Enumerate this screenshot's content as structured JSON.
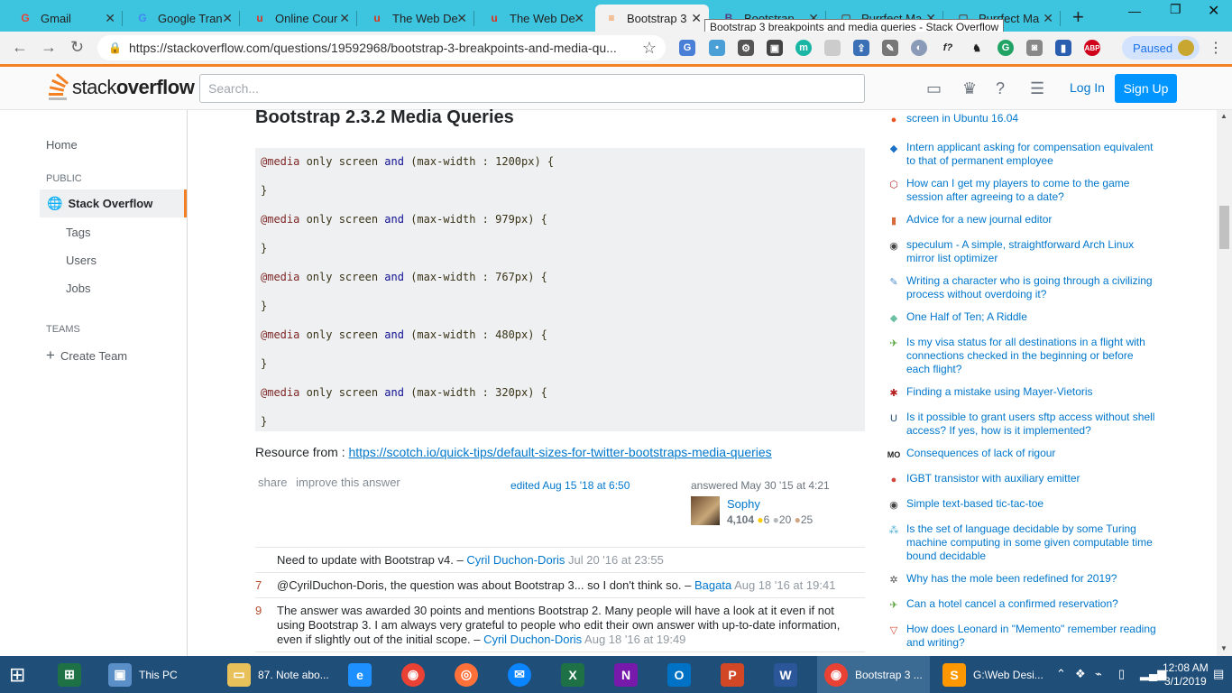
{
  "browser": {
    "tabs": [
      {
        "title": "Gmail",
        "icon": "G",
        "color": "#ea4335"
      },
      {
        "title": "Google Tran",
        "icon": "G",
        "color": "#4285f4"
      },
      {
        "title": "Online Cour",
        "icon": "u",
        "color": "#e0321c"
      },
      {
        "title": "The Web De",
        "icon": "u",
        "color": "#e0321c"
      },
      {
        "title": "The Web De",
        "icon": "u",
        "color": "#e0321c"
      },
      {
        "title": "Bootstrap 3",
        "icon": "≡",
        "color": "#f48024"
      },
      {
        "title": "Bootstrap",
        "icon": "B",
        "color": "#563d7c"
      },
      {
        "title": "Purrfect Ma",
        "icon": "▢",
        "color": "#555555"
      },
      {
        "title": "Purrfect Ma",
        "icon": "▢",
        "color": "#555555"
      }
    ],
    "tooltip": "Bootstrap 3 breakpoints and media queries - Stack Overflow",
    "url": "https://stackoverflow.com/questions/19592968/bootstrap-3-breakpoints-and-media-qu...",
    "paused_label": "Paused"
  },
  "header": {
    "logo_prefix": "stack",
    "logo_suffix": "overflow",
    "search_placeholder": "Search...",
    "login": "Log In",
    "signup": "Sign Up"
  },
  "nav": {
    "home": "Home",
    "public": "PUBLIC",
    "stackoverflow": "Stack Overflow",
    "tags": "Tags",
    "users": "Users",
    "jobs": "Jobs",
    "teams": "TEAMS",
    "create_team": "Create Team"
  },
  "answer": {
    "heading": "Bootstrap 2.3.2 Media Queries",
    "code": [
      {
        "at": "@media",
        "mid1": " only screen ",
        "and": "and",
        "mid2": " (max-width : 1200px) {"
      },
      {
        "close": "}"
      },
      {
        "at": "@media",
        "mid1": " only screen ",
        "and": "and",
        "mid2": " (max-width : 979px) {"
      },
      {
        "close": "}"
      },
      {
        "at": "@media",
        "mid1": " only screen ",
        "and": "and",
        "mid2": " (max-width : 767px) {"
      },
      {
        "close": "}"
      },
      {
        "at": "@media",
        "mid1": " only screen ",
        "and": "and",
        "mid2": " (max-width : 480px) {"
      },
      {
        "close": "}"
      },
      {
        "at": "@media",
        "mid1": " only screen ",
        "and": "and",
        "mid2": " (max-width : 320px) {"
      },
      {
        "close": "}"
      }
    ],
    "resource_label": "Resource from : ",
    "resource_link": "https://scotch.io/quick-tips/default-sizes-for-twitter-bootstraps-media-queries",
    "share": "share",
    "improve": "improve this answer",
    "edited": "edited Aug 15 '18 at 6:50",
    "answered": "answered May 30 '15 at 4:21",
    "user": {
      "name": "Sophy",
      "rep": "4,104",
      "gold": "6",
      "silver": "20",
      "bronze": "25"
    }
  },
  "comments": [
    {
      "score": "",
      "text": "Need to update with Bootstrap v4. – ",
      "author": "Cyril Duchon-Doris",
      "date": " Jul 20 '16 at 23:55"
    },
    {
      "score": "7",
      "text": "@CyrilDuchon-Doris, the question was about Bootstrap 3... so I don't think so. – ",
      "author": "Bagata",
      "date": " Aug 18 '16 at 19:41"
    },
    {
      "score": "9",
      "text": "The answer was awarded 30 points and mentions Bootstrap 2. Many people will have a look at it even if not using Bootstrap 3. I am always very grateful to people who edit their own answer with up-to-date information, even if slightly out of the initial scope. – ",
      "author": "Cyril Duchon-Doris",
      "date": " Aug 18 '16 at 19:49"
    }
  ],
  "hot_questions": [
    {
      "text": "screen in Ubuntu 16.04",
      "icon": "ubuntu-icon",
      "glyph": "●",
      "color": "#e95420"
    },
    {
      "text": "Intern applicant asking for compensation equivalent to that of permanent employee",
      "icon": "workplace-icon",
      "glyph": "◆",
      "color": "#1a6fc9"
    },
    {
      "text": "How can I get my players to come to the game session after agreeing to a date?",
      "icon": "rpg-icon",
      "glyph": "⬡",
      "color": "#b5292d"
    },
    {
      "text": "Advice for a new journal editor",
      "icon": "academia-icon",
      "glyph": "▮",
      "color": "#d86a39"
    },
    {
      "text": "speculum - A simple, straightforward Arch Linux mirror list optimizer",
      "icon": "codereview-icon",
      "glyph": "◉",
      "color": "#444444"
    },
    {
      "text": "Writing a character who is going through a civilizing process without overdoing it?",
      "icon": "writing-icon",
      "glyph": "✎",
      "color": "#4d8ed0"
    },
    {
      "text": "One Half of Ten; A Riddle",
      "icon": "puzzling-icon",
      "glyph": "◆",
      "color": "#6ac0a0"
    },
    {
      "text": "Is my visa status for all destinations in a flight with connections checked in the beginning or before each flight?",
      "icon": "travel-icon",
      "glyph": "✈",
      "color": "#58a33c"
    },
    {
      "text": "Finding a mistake using Mayer-Vietoris",
      "icon": "math-icon",
      "glyph": "✱",
      "color": "#b51d1d"
    },
    {
      "text": "Is it possible to grant users sftp access without shell access? If yes, how is it implemented?",
      "icon": "unix-icon",
      "glyph": "U",
      "color": "#234e74"
    },
    {
      "text": "Consequences of lack of rigour",
      "icon": "mathoverflow-icon",
      "glyph": "MO",
      "color": "#222222"
    },
    {
      "text": "IGBT transistor with auxiliary emitter",
      "icon": "electronics-icon",
      "glyph": "●",
      "color": "#d1463a"
    },
    {
      "text": "Simple text-based tic-tac-toe",
      "icon": "codereview-icon",
      "glyph": "◉",
      "color": "#444444"
    },
    {
      "text": "Is the set of language decidable by some Turing machine computing in some given computable time bound decidable",
      "icon": "cs-icon",
      "glyph": "⁂",
      "color": "#4fb0d6"
    },
    {
      "text": "Why has the mole been redefined for 2019?",
      "icon": "chemistry-icon",
      "glyph": "✲",
      "color": "#555555"
    },
    {
      "text": "Can a hotel cancel a confirmed reservation?",
      "icon": "travel-icon",
      "glyph": "✈",
      "color": "#58a33c"
    },
    {
      "text": "How does Leonard in \"Memento\" remember reading and writing?",
      "icon": "movies-icon",
      "glyph": "▽",
      "color": "#d04a2a"
    }
  ],
  "taskbar": {
    "items": [
      {
        "label": "This PC",
        "icon": "computer-icon"
      },
      {
        "label": "87. Note abo...",
        "icon": "folder-icon"
      },
      {
        "label": "Bootstrap 3 ...",
        "icon": "chrome-icon"
      },
      {
        "label": "G:\\Web Desi...",
        "icon": "sublime-icon"
      }
    ],
    "time": "12:08 AM",
    "date": "3/1/2019"
  }
}
